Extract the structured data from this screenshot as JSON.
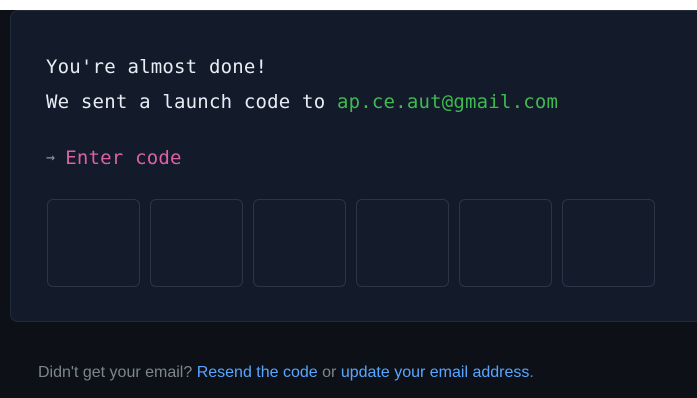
{
  "message": {
    "line1": "You're almost done!",
    "line2_prefix": "We sent a launch code to",
    "email": "ap.ce.aut@gmail.com"
  },
  "prompt": {
    "arrow": "→",
    "label": "Enter code"
  },
  "code_inputs": [
    "",
    "",
    "",
    "",
    "",
    ""
  ],
  "footer": {
    "prefix": "Didn't get your email?",
    "resend_label": "Resend the code",
    "middle": "or",
    "update_label": "update your email address",
    "suffix": "."
  }
}
